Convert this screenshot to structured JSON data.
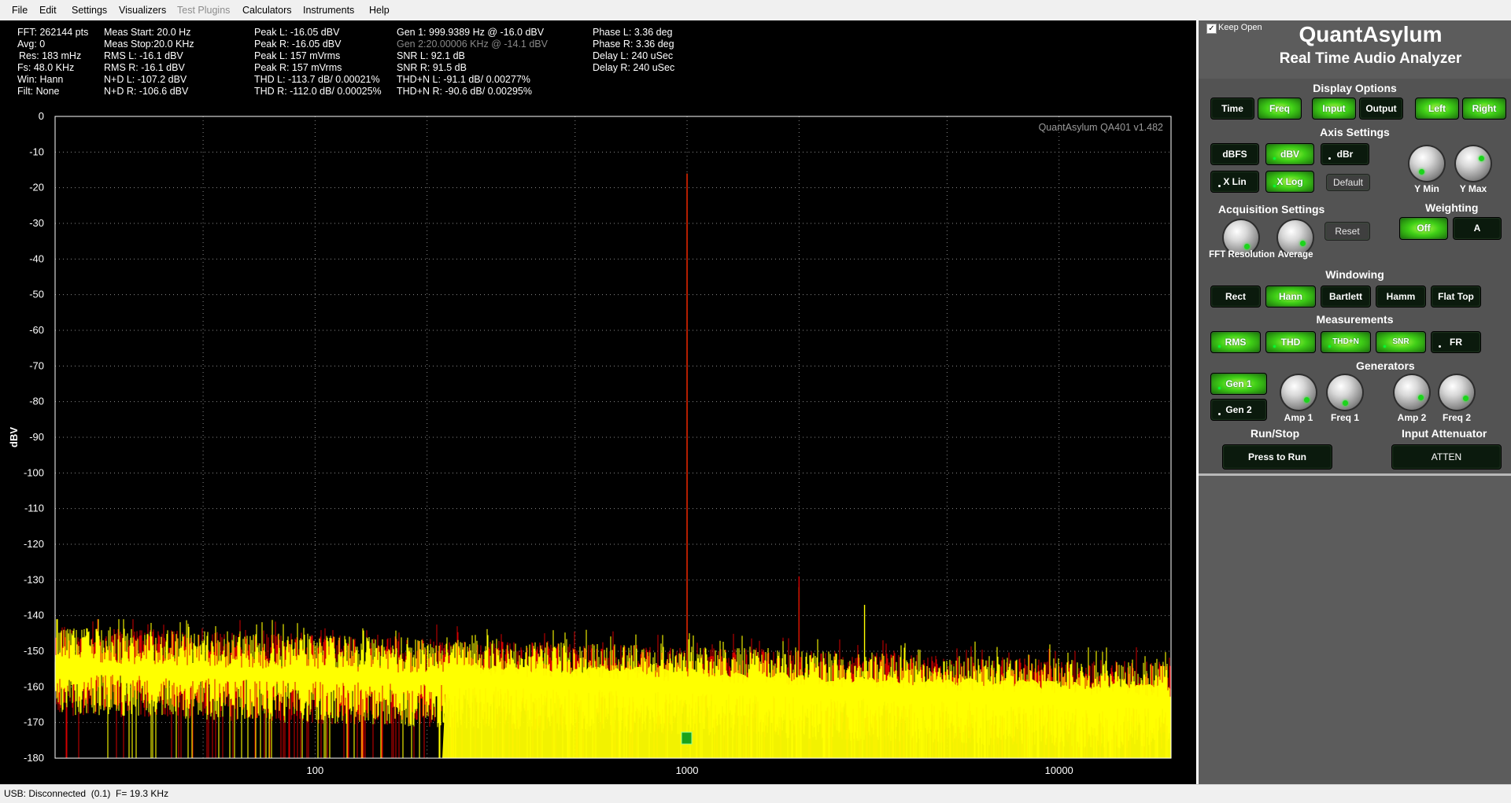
{
  "menu": {
    "items": [
      {
        "label": "File",
        "disabled": false
      },
      {
        "label": "Edit",
        "disabled": false
      },
      {
        "label": "Settings",
        "disabled": false
      },
      {
        "label": "Visualizers",
        "disabled": false
      },
      {
        "label": "Test Plugins",
        "disabled": true
      },
      {
        "label": "Calculators",
        "disabled": false
      },
      {
        "label": "Instruments",
        "disabled": false
      },
      {
        "label": "Help",
        "disabled": false
      }
    ]
  },
  "readouts": {
    "col1": [
      "FFT: 262144 pts",
      "Avg: 0",
      "Res: 183 mHz",
      "Fs: 48.0 KHz",
      "Win: Hann",
      "Filt: None"
    ],
    "col2": [
      "Meas Start: 20.0 Hz",
      "Meas Stop:20.0 KHz",
      "RMS L: -16.1 dBV",
      "RMS R: -16.1 dBV",
      "N+D L: -107.2 dBV",
      "N+D R: -106.6 dBV"
    ],
    "col3": [
      "Peak L: -16.05 dBV",
      "Peak R: -16.05 dBV",
      "Peak L: 157 mVrms",
      "Peak R: 157 mVrms",
      "THD L: -113.7 dB/ 0.00021%",
      "THD R: -112.0 dB/ 0.00025%"
    ],
    "col4": [
      "Gen 1: 999.9389 Hz @ -16.0  dBV",
      "Gen 2:20.00006 KHz @ -14.1  dBV",
      "SNR L: 92.1 dB",
      "SNR R: 91.5 dB",
      "THD+N L: -91.1 dB/ 0.00277%",
      "THD+N R: -90.6 dB/ 0.00295%"
    ],
    "col5": [
      "Phase L: 3.36 deg",
      "Phase R: 3.36 deg",
      "Delay L: 240 uSec",
      "Delay R: 240 uSec"
    ]
  },
  "chart_data": {
    "type": "line",
    "ylabel": "dBV",
    "xlabel": "",
    "watermark": "QuantAsylum QA401 v1.482",
    "x_scale": "log",
    "xlim": [
      20,
      20000
    ],
    "ylim": [
      -180,
      0
    ],
    "y_ticks": [
      0,
      -10,
      -20,
      -30,
      -40,
      -50,
      -60,
      -70,
      -80,
      -90,
      -100,
      -110,
      -120,
      -130,
      -140,
      -150,
      -160,
      -170,
      -180
    ],
    "x_ticks": [
      {
        "value": 100,
        "label": "100"
      },
      {
        "value": 1000,
        "label": "1000"
      },
      {
        "value": 10000,
        "label": "10000"
      }
    ],
    "grid": true,
    "colors": {
      "left": "#ffff00",
      "right": "#d40000",
      "background": "#000000",
      "grid": "#8a8a8a"
    },
    "series": [
      {
        "channel": "left",
        "peaks": [
          {
            "x": 999.94,
            "y": -16.05
          },
          {
            "x": 2000,
            "y": -132
          },
          {
            "x": 3000,
            "y": -137
          }
        ]
      },
      {
        "channel": "right",
        "peaks": [
          {
            "x": 999.94,
            "y": -16.05
          },
          {
            "x": 2000,
            "y": -129
          }
        ]
      }
    ],
    "noise_floor": {
      "low_freq_level": -148,
      "high_freq_level": -158,
      "min": -180
    }
  },
  "panel": {
    "keep_open_label": "Keep Open",
    "keep_open_checked": true,
    "brand": "QuantAsylum",
    "subtitle": "Real Time Audio Analyzer",
    "display_options": {
      "title": "Display Options",
      "buttons": [
        {
          "label": "Time",
          "on": false
        },
        {
          "label": "Freq",
          "on": true
        },
        {
          "label": "Input",
          "on": true
        },
        {
          "label": "Output",
          "on": false
        },
        {
          "label": "Left",
          "on": true
        },
        {
          "label": "Right",
          "on": true
        }
      ]
    },
    "axis_settings": {
      "title": "Axis Settings",
      "dbfs": "dBFS",
      "dbv": "dBV",
      "dbr": "dBr",
      "xlin": "X Lin",
      "xlog": "X Log",
      "default": "Default",
      "ymin": "Y Min",
      "ymax": "Y Max"
    },
    "acquisition": {
      "title": "Acquisition Settings",
      "fft": "FFT Resolution",
      "average": "Average",
      "reset": "Reset"
    },
    "weighting": {
      "title": "Weighting",
      "off": "Off",
      "a": "A"
    },
    "windowing": {
      "title": "Windowing",
      "buttons": [
        {
          "label": "Rect",
          "on": false
        },
        {
          "label": "Hann",
          "on": true
        },
        {
          "label": "Bartlett",
          "on": false
        },
        {
          "label": "Hamm",
          "on": false
        },
        {
          "label": "Flat Top",
          "on": false
        }
      ]
    },
    "measurements": {
      "title": "Measurements",
      "buttons": [
        {
          "label": "RMS",
          "on": true
        },
        {
          "label": "THD",
          "on": true
        },
        {
          "label": "THD+N",
          "on": true
        },
        {
          "label": "SNR",
          "on": true
        },
        {
          "label": "FR",
          "on": false
        }
      ]
    },
    "generators": {
      "title": "Generators",
      "gen1": "Gen 1",
      "gen2": "Gen 2",
      "amp1": "Amp 1",
      "freq1": "Freq 1",
      "amp2": "Amp 2",
      "freq2": "Freq 2"
    },
    "runstop": {
      "title": "Run/Stop",
      "button": "Press to Run"
    },
    "atten": {
      "title": "Input Attenuator",
      "button": "ATTEN"
    }
  },
  "status": {
    "text": "USB: Disconnected  (0.1)  F= 19.3 KHz"
  }
}
